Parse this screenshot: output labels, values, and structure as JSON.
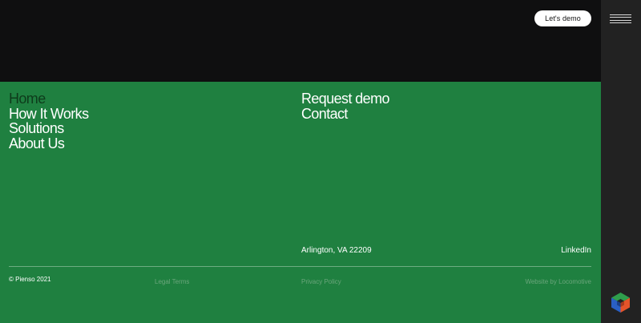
{
  "header": {
    "demo_button_label": "Let's demo"
  },
  "nav_main": [
    {
      "label": "Home"
    },
    {
      "label": "How It Works"
    },
    {
      "label": "Solutions"
    },
    {
      "label": "About Us"
    }
  ],
  "nav_secondary": [
    {
      "label": "Request demo"
    },
    {
      "label": "Contact"
    }
  ],
  "footer": {
    "address": "Arlington, VA 22209",
    "social_link": "LinkedIn",
    "copyright": "© Pienso 2021",
    "legal_link": "Legal Terms",
    "privacy_link": "Privacy Policy",
    "credit_link": "Website by Locomotive"
  },
  "colors": {
    "footer_bg": "#1f8040",
    "top_bg": "#0f0f10",
    "sidebar_bg": "#222222",
    "active_nav": "#0e3b1b"
  },
  "icons": {
    "menu": "hamburger-menu-icon",
    "logo": "cube-logo-icon"
  }
}
